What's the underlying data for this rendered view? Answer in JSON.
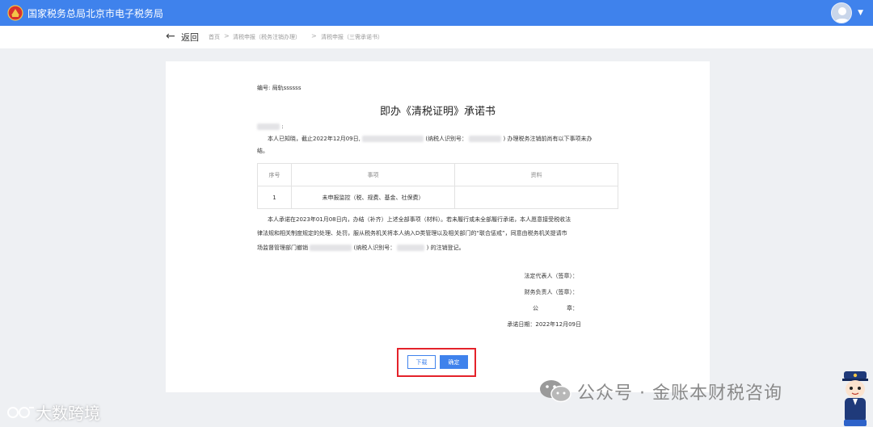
{
  "header": {
    "site_title": "国家税务总局北京市电子税务局",
    "brand_color": "#3f82ec",
    "logo_icon": "tax-emblem-icon",
    "avatar_icon": "user-avatar-icon"
  },
  "nav": {
    "back_label": "返回",
    "breadcrumb": [
      "首页",
      "清税申报（税务注销办理）",
      "清税申报（三需承诺书）"
    ]
  },
  "document": {
    "number_label": "编号: 局轨ssssss",
    "title": "即办《清税证明》承诺书",
    "salutation_suffix": ":",
    "para1_a": "本人已知晓，截止2022年12月09日,",
    "para1_b": "(纳税人识别号：",
    "para1_c": ")  办理税务注销前尚有以下事项未办",
    "para1_d": "结。",
    "table": {
      "headers": [
        "序号",
        "事项",
        "资料"
      ],
      "rows": [
        [
          "1",
          "未申报监控（税、规费、基金、社保费）",
          ""
        ]
      ]
    },
    "para2_l1": "本人承诺在2023年01月08日内，办结（补齐）上述全部事项（材料）。若未履行或未全部履行承诺，本人愿意接受税收法",
    "para2_l2": "律法规和相关制度规定的处理、处罚，服从税务机关将本人纳入D类管理以及相关部门的“联合惩戒”，同意由税务机关提请市",
    "para2_l3_a": "场监督管理部门撤销",
    "para2_l3_b": "(纳税人识别号：",
    "para2_l3_c": ")  的注销登记。",
    "sign_legal": "法定代表人（签章）：",
    "sign_finance": "财务负责人（签章）：",
    "sign_seal": "公　　　　　章：",
    "sign_date": "承诺日期：2022年12月09日"
  },
  "actions": {
    "download_label": "下载",
    "confirm_label": "确定",
    "highlight_color": "#e4222a"
  },
  "watermarks": {
    "left_text": "大数跨境",
    "right_text": "公众号 · 金账本财税咨询",
    "right_icon": "wechat-icon",
    "mascot_icon": "tax-officer-mascot-icon"
  }
}
